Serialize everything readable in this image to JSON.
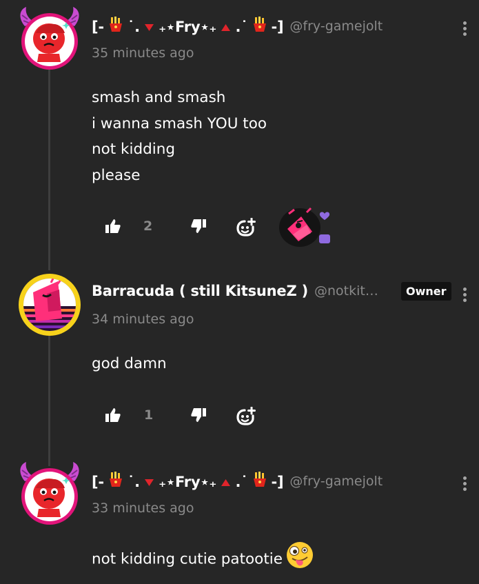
{
  "thread": {
    "comments": [
      {
        "display_name_prefix": "[-",
        "display_name_mid1": "˙.",
        "display_name_mid2": "₊⋆",
        "display_name_core": "Fry",
        "display_name_mid3": "⋆₊",
        "display_name_mid4": ".˙",
        "display_name_suffix": "-]",
        "username": "@fry-gamejolt",
        "timestamp": "35 minutes ago",
        "lines": [
          "smash and smash",
          "i wanna smash YOU too",
          "not kidding",
          "please"
        ],
        "like_count": "2",
        "has_reaction_sticker": true
      },
      {
        "display_name": "Barracuda ( still KitsuneZ )",
        "username": "@notkitsunez",
        "badge": "Owner",
        "timestamp": "34 minutes ago",
        "lines": [
          "god damn"
        ],
        "like_count": "1"
      },
      {
        "display_name_prefix": "[-",
        "display_name_mid1": "˙.",
        "display_name_mid2": "₊⋆",
        "display_name_core": "Fry",
        "display_name_mid3": "⋆₊",
        "display_name_mid4": ".˙",
        "display_name_suffix": "-]",
        "username": "@fry-gamejolt",
        "timestamp": "33 minutes ago",
        "text": "not kidding cutie patootie",
        "emoji": "zany-face"
      }
    ]
  },
  "icons": {
    "like": "thumbs-up-icon",
    "dislike": "thumbs-down-icon",
    "add_reaction": "add-sticker-icon",
    "more": "kebab-menu-icon",
    "fries": "french-fries-emoji",
    "red_down": "red-triangle-down-emoji",
    "red_up": "red-triangle-up-emoji"
  },
  "colors": {
    "background": "#262626",
    "text": "#ffffff",
    "muted": "#8a8a8a",
    "badge_bg": "#121212",
    "fry_avatar_ring": "#e2147a",
    "fry_horn": "#c94bd1",
    "barracuda_ring": "#f7d21b",
    "accent_pink": "#ff2f7a",
    "accent_purple": "#8f6ae0"
  }
}
